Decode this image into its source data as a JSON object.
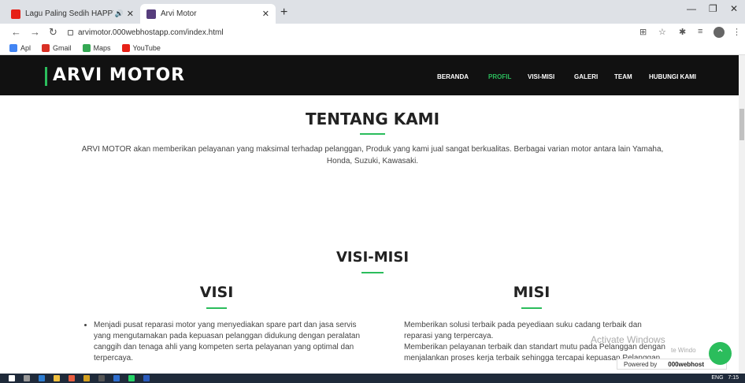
{
  "browser": {
    "tabs": [
      {
        "title": "Lagu Paling Sedih HAPPY AS",
        "favicon_color": "#e62117"
      },
      {
        "title": "Arvi Motor",
        "favicon_color": "#563d7c"
      }
    ],
    "url": "arvimotor.000webhostapp.com/index.html",
    "bookmarks": [
      {
        "label": "Apl",
        "color": "#4285f4"
      },
      {
        "label": "Gmail",
        "color": "#d93025"
      },
      {
        "label": "Maps",
        "color": "#34a853"
      },
      {
        "label": "YouTube",
        "color": "#e62117"
      }
    ]
  },
  "site": {
    "logo": "ARVI MOTOR",
    "accent": "#2bbd5c",
    "menu": [
      "BERANDA",
      "PROFIL",
      "VISI-MISI",
      "GALERI",
      "TEAM",
      "HUBUNGI KAMI"
    ],
    "active_menu": "PROFIL",
    "about": {
      "title": "TENTANG KAMI",
      "text": "ARVI MOTOR akan memberikan pelayanan yang maksimal terhadap pelanggan, Produk yang kami jual sangat berkualitas. Berbagai varian motor antara lain Yamaha, Honda, Suzuki, Kawasaki."
    },
    "visimisi": {
      "title": "VISI-MISI",
      "visi_title": "VISI",
      "visi_items": [
        "Menjadi pusat reparasi motor yang menyediakan spare part dan jasa servis yang mengutamakan pada kepuasan pelanggan didukung dengan peralatan canggih dan tenaga ahli yang kompeten serta pelayanan yang optimal dan terpercaya."
      ],
      "misi_title": "MISI",
      "misi_items": [
        "Memberikan solusi terbaik pada peyediaan suku cadang terbaik dan reparasi yang terpercaya.",
        "Memberikan pelayanan terbaik dan standart mutu pada Pelanggan dengan menjalankan proses kerja terbaik sehingga tercapai kepuasan Pelanggan"
      ]
    }
  },
  "overlay": {
    "activate": "Activate Windows",
    "activate_sub": "te Windo",
    "powered_by": "Powered by",
    "host": "000webhost"
  },
  "taskbar": {
    "lang": "ENG",
    "time": "7:15"
  }
}
